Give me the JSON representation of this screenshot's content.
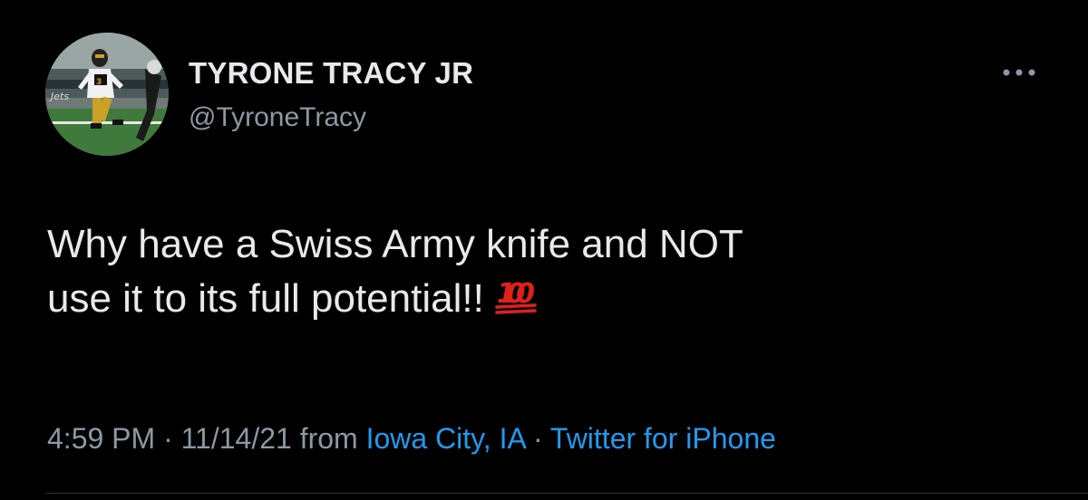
{
  "author": {
    "display_name": "TYRONE TRACY JR",
    "handle": "@TyroneTracy",
    "avatar_icon": "football-player-avatar"
  },
  "menu": {
    "icon": "more-horizontal-icon"
  },
  "tweet": {
    "text_line_1": "Why have a Swiss Army knife and NOT",
    "text_line_2": "use it to its full potential!!",
    "emoji": "💯"
  },
  "meta": {
    "time": "4:59 PM",
    "sep1": " · ",
    "date": "11/14/21",
    "from": " from ",
    "location": "Iowa City, IA",
    "sep2": " · ",
    "source": "Twitter for iPhone"
  },
  "colors": {
    "background": "#000000",
    "text": "#e7e9ea",
    "secondary": "#8b98a5",
    "link": "#1d9bf0",
    "emoji_red": "#e0201a"
  }
}
